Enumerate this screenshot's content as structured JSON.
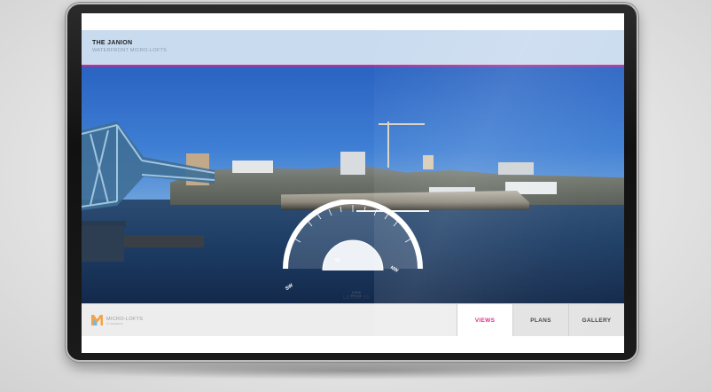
{
  "header": {
    "title": "THE JANION",
    "subtitle": "WATERFRONT MICRO-LOFTS"
  },
  "compass": {
    "directions": [
      "SW",
      "W",
      "NW"
    ],
    "caption": "VIEW FROM",
    "level": "LEVEL 05"
  },
  "footer": {
    "logo_text": "MICRO-LOFTS",
    "logo_sub": "BY RESIDENCE"
  },
  "nav": {
    "tabs": [
      {
        "label": "VIEWS",
        "active": true
      },
      {
        "label": "PLANS",
        "active": false
      },
      {
        "label": "GALLERY",
        "active": false
      }
    ]
  },
  "colors": {
    "accent": "#e0208c",
    "header_bg": "#c9dbef",
    "footer_bg": "#ededed"
  },
  "icons": {
    "logo": "micro-lofts-logo-icon",
    "compass": "compass-dial-icon"
  }
}
